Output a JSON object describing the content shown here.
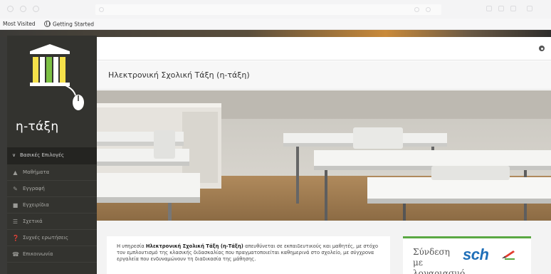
{
  "browser": {
    "bookmarks": [
      {
        "label": "Most Visited"
      },
      {
        "label": "Getting Started"
      }
    ]
  },
  "sidebar": {
    "logo_text": "η-τάξη",
    "menu_header": "Βασικές Επιλογές",
    "items": [
      {
        "label": "Μαθήματα",
        "icon": "graduation-cap-icon"
      },
      {
        "label": "Εγγραφή",
        "icon": "edit-icon"
      },
      {
        "label": "Εγχειρίδια",
        "icon": "book-icon"
      },
      {
        "label": "Σχετικά",
        "icon": "list-icon"
      },
      {
        "label": "Συχνές ερωτήσεις",
        "icon": "question-icon"
      },
      {
        "label": "Επικοινωνία",
        "icon": "phone-icon"
      }
    ]
  },
  "main": {
    "title": "Ηλεκτρονική Σχολική Τάξη (η-τάξη)",
    "intro": {
      "prefix": "Η υπηρεσία ",
      "bold": "Ηλεκτρονική Σχολική Τάξη (η-Τάξη)",
      "rest": " απευθύνεται σε εκπαιδευτικούς και μαθητές, με στόχο τον εμπλουτισμό της κλασικής διδασκαλίας που πραγματοποιείται καθημερινά στο σχολείο, με σύγχρονα εργαλεία που ενδυναμώνουν τη διαδικασία της μάθησης."
    },
    "login": {
      "text": "Σύνδεση με λογαριασμό",
      "logo": "sch"
    }
  },
  "colors": {
    "sidebar_bg": "#33332f",
    "accent_green": "#5aa842",
    "sch_blue": "#1f6fb8"
  }
}
